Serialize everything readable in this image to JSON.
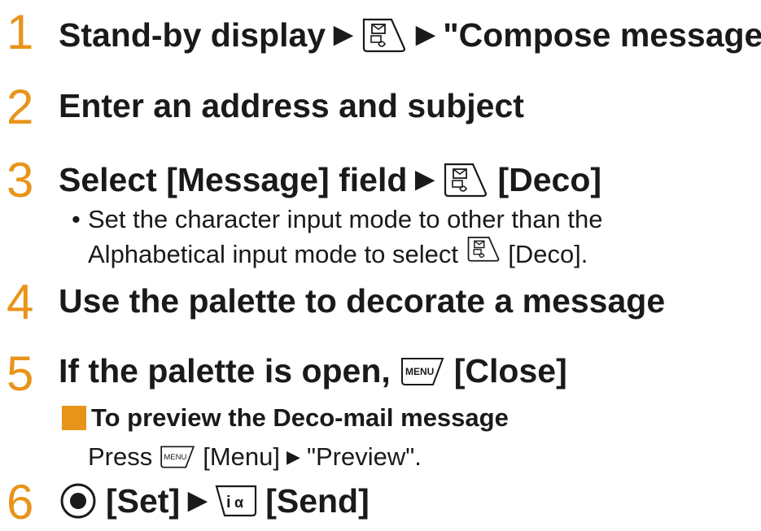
{
  "accent_color": "#e8941a",
  "steps": [
    {
      "number": "1",
      "parts": [
        "Stand-by display",
        "▶",
        "mail-key-icon",
        "▶",
        "\"Compose message\""
      ]
    },
    {
      "number": "2",
      "text": "Enter an address and subject"
    },
    {
      "number": "3",
      "text_a": "Select [Message] field",
      "arrow": "▶",
      "text_b": "[Deco]",
      "note_bullet": "•",
      "note_line1": "Set the character input mode to other than the",
      "note_line2a": "Alphabetical input mode to select",
      "note_line2b": "[Deco]."
    },
    {
      "number": "4",
      "text": "Use the palette to decorate a message"
    },
    {
      "number": "5",
      "text_a": "If the palette is open,",
      "text_b": "[Close]",
      "sub_heading": "To preview the Deco-mail message",
      "sub_press": "Press",
      "sub_menu": "[Menu]",
      "sub_arrow": "▶",
      "sub_preview": "\"Preview\"."
    },
    {
      "number": "6",
      "text_a": "[Set]",
      "arrow": "▶",
      "text_b": "[Send]"
    }
  ],
  "step1": {
    "text_a": "Stand-by display",
    "arrow1": "▶",
    "arrow2": "▶",
    "text_b": "\"Compose message\""
  },
  "menu_key_label": "MENU"
}
